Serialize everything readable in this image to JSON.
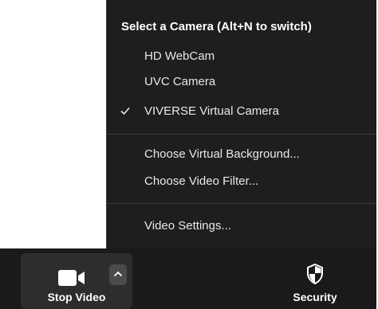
{
  "camera_menu": {
    "title": "Select a Camera (Alt+N to switch)",
    "cameras": [
      {
        "label": "HD WebCam",
        "checked": false
      },
      {
        "label": "UVC Camera",
        "checked": false
      },
      {
        "label": "VIVERSE Virtual Camera",
        "checked": true
      }
    ],
    "options": [
      {
        "label": "Choose Virtual Background..."
      },
      {
        "label": "Choose Video Filter..."
      }
    ],
    "settings_label": "Video Settings..."
  },
  "toolbar": {
    "stop_video_label": "Stop Video",
    "security_label": "Security",
    "stop_video_icon": "video-camera-icon",
    "caret_icon": "chevron-up-icon",
    "security_icon": "shield-icon"
  },
  "colors": {
    "menu_bg": "#1e1e1e",
    "toolbar_bg": "#1a1a1a",
    "button_bg": "#2d2d2d",
    "text": "#ffffff"
  }
}
